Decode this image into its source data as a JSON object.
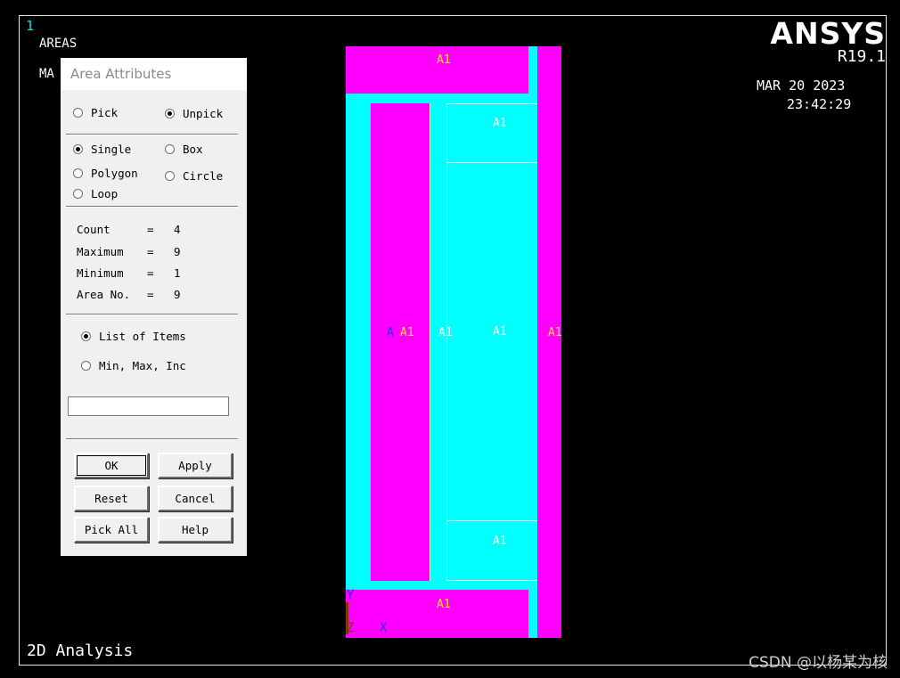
{
  "graphics": {
    "window_number": "1",
    "plot_title": "AREAS",
    "plot_subtitle_visible": "MA",
    "brand": "ANSYS",
    "release": "R19.1",
    "date": "MAR 20 2023",
    "time": "23:42:29",
    "analysis_type": "2D Analysis",
    "watermark": "CSDN @以杨某为核",
    "area_label": "A1",
    "area_label_partial": "A",
    "axis_y": "Y",
    "axis_z": "Z",
    "axis_x": "X",
    "colors": {
      "magenta": "#ff00ff",
      "cyan": "#00ffff",
      "yellow_label": "#ffe030",
      "blue_label": "#2b2bff"
    }
  },
  "dialog": {
    "title": "Area Attributes",
    "pick_mode": [
      {
        "label": "Pick",
        "selected": false
      },
      {
        "label": "Unpick",
        "selected": true
      }
    ],
    "selection_shape": [
      {
        "label": "Single",
        "selected": true
      },
      {
        "label": "Box",
        "selected": false
      },
      {
        "label": "Polygon",
        "selected": false
      },
      {
        "label": "Circle",
        "selected": false
      },
      {
        "label": "Loop",
        "selected": false
      }
    ],
    "stats": {
      "count_label": "Count",
      "count_value": "4",
      "maximum_label": "Maximum",
      "maximum_value": "9",
      "minimum_label": "Minimum",
      "minimum_value": "1",
      "area_no_label": "Area No.",
      "area_no_value": "9",
      "equals": "="
    },
    "entry_mode": [
      {
        "label": "List of Items",
        "selected": true
      },
      {
        "label": "Min, Max, Inc",
        "selected": false
      }
    ],
    "input_value": "",
    "buttons": {
      "ok": "OK",
      "apply": "Apply",
      "reset": "Reset",
      "cancel": "Cancel",
      "pick_all": "Pick All",
      "help": "Help"
    }
  }
}
